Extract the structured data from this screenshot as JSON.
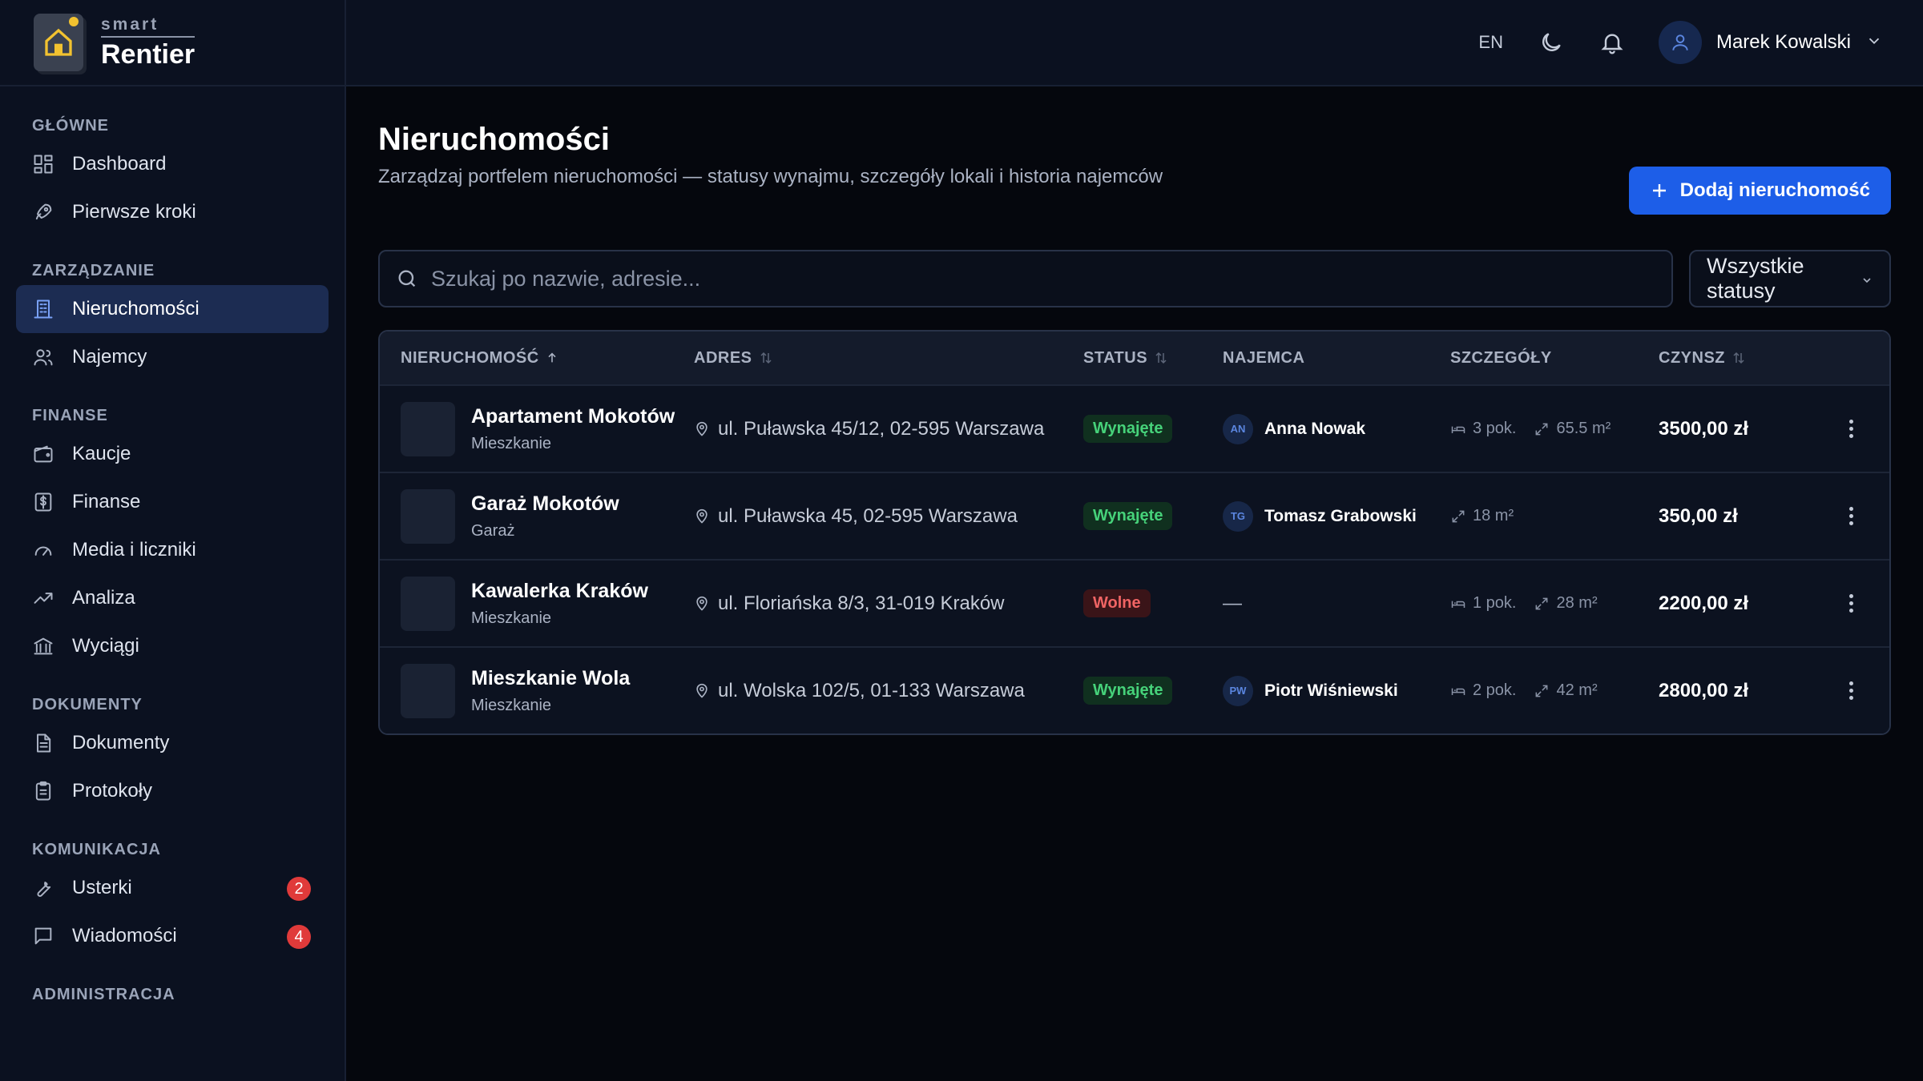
{
  "brand": {
    "small": "smart",
    "big": "Rentier"
  },
  "topbar": {
    "lang": "EN",
    "user_name": "Marek Kowalski"
  },
  "sidebar": {
    "sections": [
      {
        "heading": "GŁÓWNE",
        "items": [
          {
            "label": "Dashboard",
            "icon": "dashboard-icon"
          },
          {
            "label": "Pierwsze kroki",
            "icon": "rocket-icon"
          }
        ]
      },
      {
        "heading": "ZARZĄDZANIE",
        "items": [
          {
            "label": "Nieruchomości",
            "icon": "building-icon",
            "active": true
          },
          {
            "label": "Najemcy",
            "icon": "users-icon"
          }
        ]
      },
      {
        "heading": "FINANSE",
        "items": [
          {
            "label": "Kaucje",
            "icon": "wallet-icon"
          },
          {
            "label": "Finanse",
            "icon": "dollar-icon"
          },
          {
            "label": "Media i liczniki",
            "icon": "gauge-icon"
          },
          {
            "label": "Analiza",
            "icon": "trend-icon"
          },
          {
            "label": "Wyciągi",
            "icon": "bank-icon"
          }
        ]
      },
      {
        "heading": "DOKUMENTY",
        "items": [
          {
            "label": "Dokumenty",
            "icon": "document-icon"
          },
          {
            "label": "Protokoły",
            "icon": "clipboard-icon"
          }
        ]
      },
      {
        "heading": "KOMUNIKACJA",
        "items": [
          {
            "label": "Usterki",
            "icon": "wrench-icon",
            "badge": "2"
          },
          {
            "label": "Wiadomości",
            "icon": "message-icon",
            "badge": "4"
          }
        ]
      },
      {
        "heading": "ADMINISTRACJA",
        "items": []
      }
    ]
  },
  "page": {
    "title": "Nieruchomości",
    "subtitle": "Zarządzaj portfelem nieruchomości — statusy wynajmu, szczegóły lokali i historia najemców",
    "add_button": "Dodaj nieruchomość"
  },
  "filters": {
    "search_placeholder": "Szukaj po nazwie, adresie...",
    "status_value": "Wszystkie statusy"
  },
  "table": {
    "headers": {
      "property": "NIERUCHOMOŚĆ",
      "address": "ADRES",
      "status": "STATUS",
      "tenant": "NAJEMCA",
      "details": "SZCZEGÓŁY",
      "rent": "CZYNSZ"
    },
    "rows": [
      {
        "name": "Apartament Mokotów",
        "type": "Mieszkanie",
        "address": "ul. Puławska 45/12, 02-595 Warszawa",
        "status": "Wynajęte",
        "status_kind": "rented",
        "tenant_initials": "AN",
        "tenant": "Anna Nowak",
        "rooms": "3 pok.",
        "area": "65.5 m²",
        "rent": "3500,00 zł"
      },
      {
        "name": "Garaż Mokotów",
        "type": "Garaż",
        "address": "ul. Puławska 45, 02-595 Warszawa",
        "status": "Wynajęte",
        "status_kind": "rented",
        "tenant_initials": "TG",
        "tenant": "Tomasz Grabowski",
        "rooms": "",
        "area": "18 m²",
        "rent": "350,00 zł"
      },
      {
        "name": "Kawalerka Kraków",
        "type": "Mieszkanie",
        "address": "ul. Floriańska 8/3, 31-019 Kraków",
        "status": "Wolne",
        "status_kind": "free",
        "tenant_initials": "",
        "tenant": "—",
        "rooms": "1 pok.",
        "area": "28 m²",
        "rent": "2200,00 zł"
      },
      {
        "name": "Mieszkanie Wola",
        "type": "Mieszkanie",
        "address": "ul. Wolska 102/5, 01-133 Warszawa",
        "status": "Wynajęte",
        "status_kind": "rented",
        "tenant_initials": "PW",
        "tenant": "Piotr Wiśniewski",
        "rooms": "2 pok.",
        "area": "42 m²",
        "rent": "2800,00 zł"
      }
    ]
  },
  "colors": {
    "accent": "#1d5ee8",
    "rented": "#46d27a",
    "free": "#f06464",
    "badge": "#e03a3a"
  }
}
